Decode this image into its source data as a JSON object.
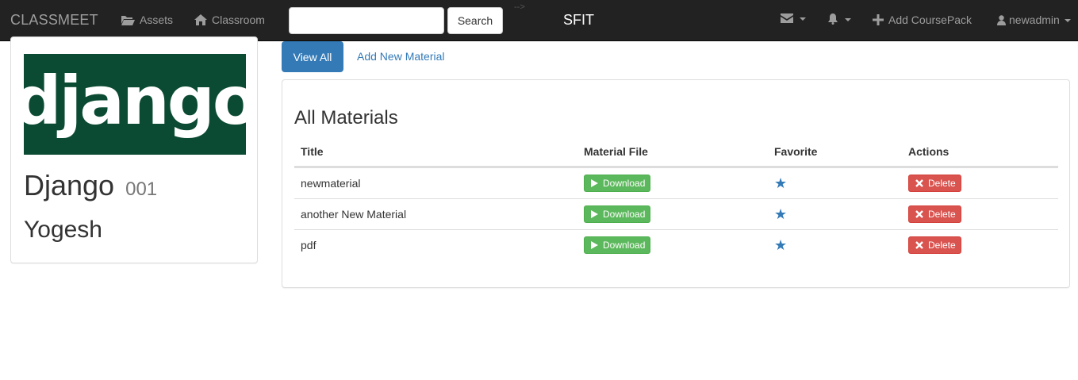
{
  "navbar": {
    "brand": "CLASSMEET",
    "assets_label": "Assets",
    "classroom_label": "Classroom",
    "search_placeholder": "",
    "search_button": "Search",
    "stray_text": "-->",
    "center_title": "SFIT",
    "add_coursepack_label": "Add CoursePack",
    "user_label": "newadmin"
  },
  "course": {
    "logo_text": "django",
    "name": "Django",
    "code": "001",
    "teacher": "Yogesh"
  },
  "tabs": {
    "view_all": "View All",
    "add_new": "Add New Material"
  },
  "materials": {
    "title": "All Materials",
    "columns": [
      "Title",
      "Material File",
      "Favorite",
      "Actions"
    ],
    "rows": [
      {
        "title": "newmaterial",
        "file_button": "Download",
        "delete_button": "Delete"
      },
      {
        "title": "another New Material",
        "file_button": "Download",
        "delete_button": "Delete"
      },
      {
        "title": "pdf",
        "file_button": "Download",
        "delete_button": "Delete"
      }
    ]
  },
  "colors": {
    "navbar_bg": "#222222",
    "primary": "#337ab7",
    "success": "#5cb85c",
    "danger": "#d9534f",
    "logo_bg": "#0c4b33"
  }
}
